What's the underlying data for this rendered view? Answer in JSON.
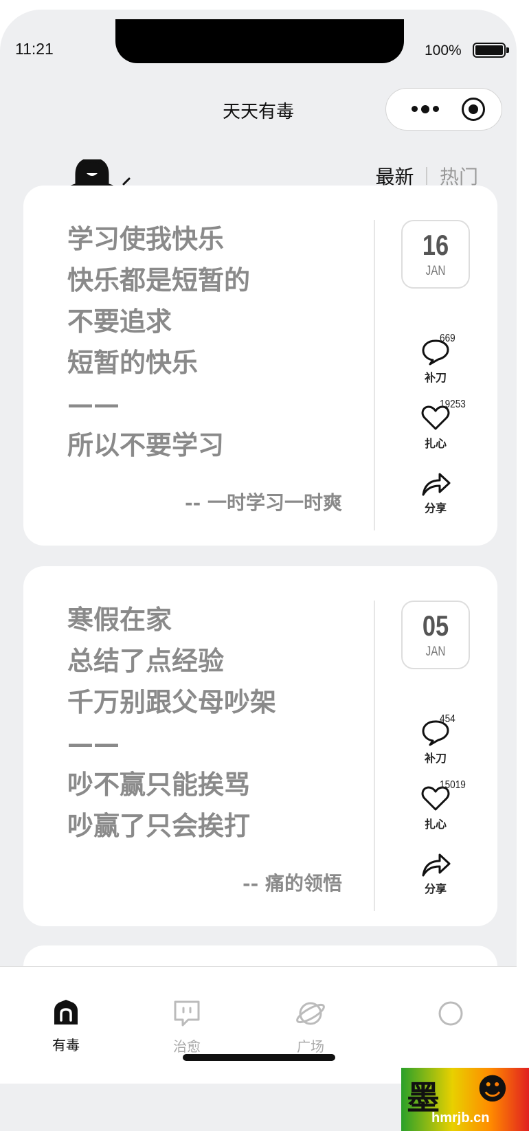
{
  "status_bar": {
    "time": "11:21",
    "battery": "100%"
  },
  "nav": {
    "title": "天天有毒"
  },
  "sort_tabs": {
    "latest": "最新",
    "hot": "热门"
  },
  "cards": [
    {
      "quote": "学习使我快乐\n快乐都是短暂的\n不要追求\n短暂的快乐\n——\n所以不要学习",
      "author": "-- 一时学习一时爽",
      "day": "16",
      "month": "JAN",
      "comments": "669",
      "comment_label": "补刀",
      "likes": "19253",
      "like_label": "扎心",
      "share_label": "分享"
    },
    {
      "quote": "寒假在家\n总结了点经验\n千万别跟父母吵架\n——\n吵不赢只能挨骂\n吵赢了只会挨打",
      "author": "-- 痛的领悟",
      "day": "05",
      "month": "JAN",
      "comments": "454",
      "comment_label": "补刀",
      "likes": "15019",
      "like_label": "扎心",
      "share_label": "分享"
    }
  ],
  "tabbar": [
    {
      "label": "有毒",
      "icon": "home-icon",
      "active": true
    },
    {
      "label": "治愈",
      "icon": "chat-bubble-icon",
      "active": false
    },
    {
      "label": "广场",
      "icon": "planet-icon",
      "active": false
    },
    {
      "label": "",
      "icon": "search-icon",
      "active": false
    }
  ],
  "watermark": {
    "text": "hmrjb.cn"
  }
}
